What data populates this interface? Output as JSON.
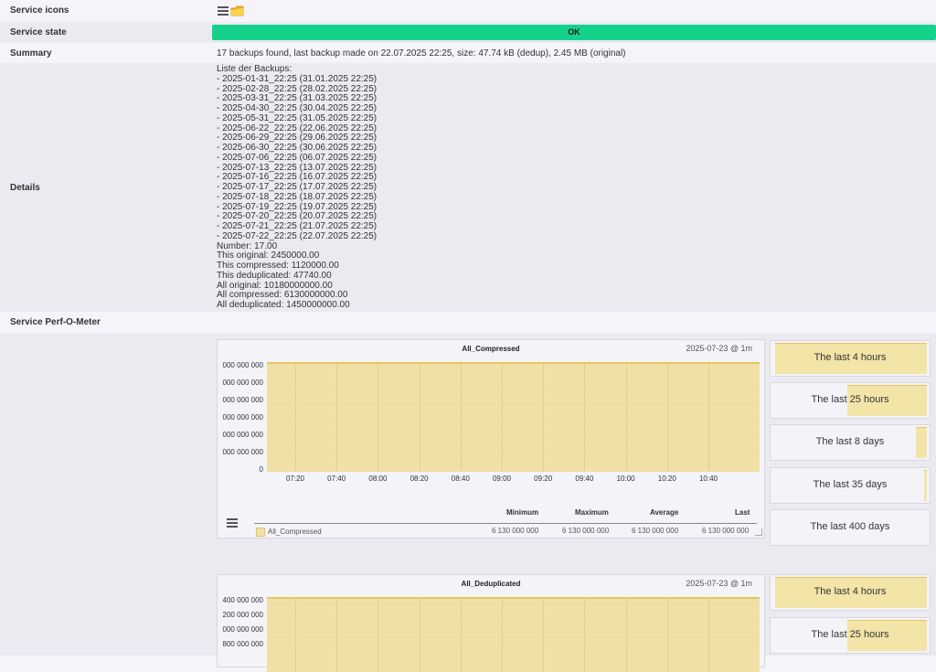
{
  "rows": {
    "icons_label": "Service icons",
    "state_label": "Service state",
    "state_value": "OK",
    "summary_label": "Summary",
    "summary_value": "17 backups found, last backup made on 22.07.2025 22:25, size: 47.74 kB (dedup), 2.45 MB (original)",
    "details_label": "Details",
    "details_lines": [
      "Liste der Backups:",
      "- 2025-01-31_22:25 (31.01.2025 22:25)",
      "- 2025-02-28_22:25 (28.02.2025 22:25)",
      "- 2025-03-31_22:25 (31.03.2025 22:25)",
      "- 2025-04-30_22:25 (30.04.2025 22:25)",
      "- 2025-05-31_22:25 (31.05.2025 22:25)",
      "- 2025-06-22_22:25 (22.06.2025 22:25)",
      "- 2025-06-29_22:25 (29.06.2025 22:25)",
      "- 2025-06-30_22:25 (30.06.2025 22:25)",
      "- 2025-07-06_22:25 (06.07.2025 22:25)",
      "- 2025-07-13_22:25 (13.07.2025 22:25)",
      "- 2025-07-16_22:25 (16.07.2025 22:25)",
      "- 2025-07-17_22:25 (17.07.2025 22:25)",
      "- 2025-07-18_22:25 (18.07.2025 22:25)",
      "- 2025-07-19_22:25 (19.07.2025 22:25)",
      "- 2025-07-20_22:25 (20.07.2025 22:25)",
      "- 2025-07-21_22:25 (21.07.2025 22:25)",
      "- 2025-07-22_22:25 (22.07.2025 22:25)",
      "Number: 17.00",
      "This original: 2450000.00",
      "This compressed: 1120000.00",
      "This deduplicated: 47740.00",
      "All original: 10180000000.00",
      "All compressed: 6130000000.00",
      "All deduplicated: 1450000000.00"
    ],
    "perf_label": "Service Perf-O-Meter"
  },
  "colors": {
    "ok": "#14d28b",
    "graph_fill": "#f0e0a8",
    "graph_line": "#e5c760"
  },
  "icons": [
    "menu-icon",
    "folder-icon"
  ],
  "graphs": [
    {
      "title": "All_Compressed",
      "date": "2025-07-23 @ 1m",
      "y_labels": [
        "000 000 000",
        "000 000 000",
        "000 000 000",
        "000 000 000",
        "000 000 000",
        "000 000 000",
        "0"
      ],
      "x_labels": [
        "07:20",
        "07:40",
        "08:00",
        "08:20",
        "08:40",
        "09:00",
        "09:20",
        "09:40",
        "10:00",
        "10:20",
        "10:40"
      ],
      "legend_headers": [
        "Minimum",
        "Maximum",
        "Average",
        "Last"
      ],
      "series_name": "All_Compressed",
      "stats": [
        "6 130 000 000",
        "6 130 000 000",
        "6 130 000 000",
        "6 130 000 000"
      ]
    },
    {
      "title": "All_Deduplicated",
      "date": "2025-07-23 @ 1m",
      "y_labels": [
        "400 000 000",
        "200 000 000",
        "000 000 000",
        "800 000 000"
      ]
    }
  ],
  "timeranges": [
    {
      "label": "The last 4 hours",
      "level": 0.99
    },
    {
      "label": "The last 25 hours",
      "level": 0.52
    },
    {
      "label": "The last 8 days",
      "level": 0.07
    },
    {
      "label": "The last 35 days",
      "level": 0.02
    },
    {
      "label": "The last 400 days",
      "level": 0.0
    },
    {
      "label": "The last 4 hours",
      "level": 0.99
    },
    {
      "label": "The last 25 hours",
      "level": 0.52
    }
  ]
}
